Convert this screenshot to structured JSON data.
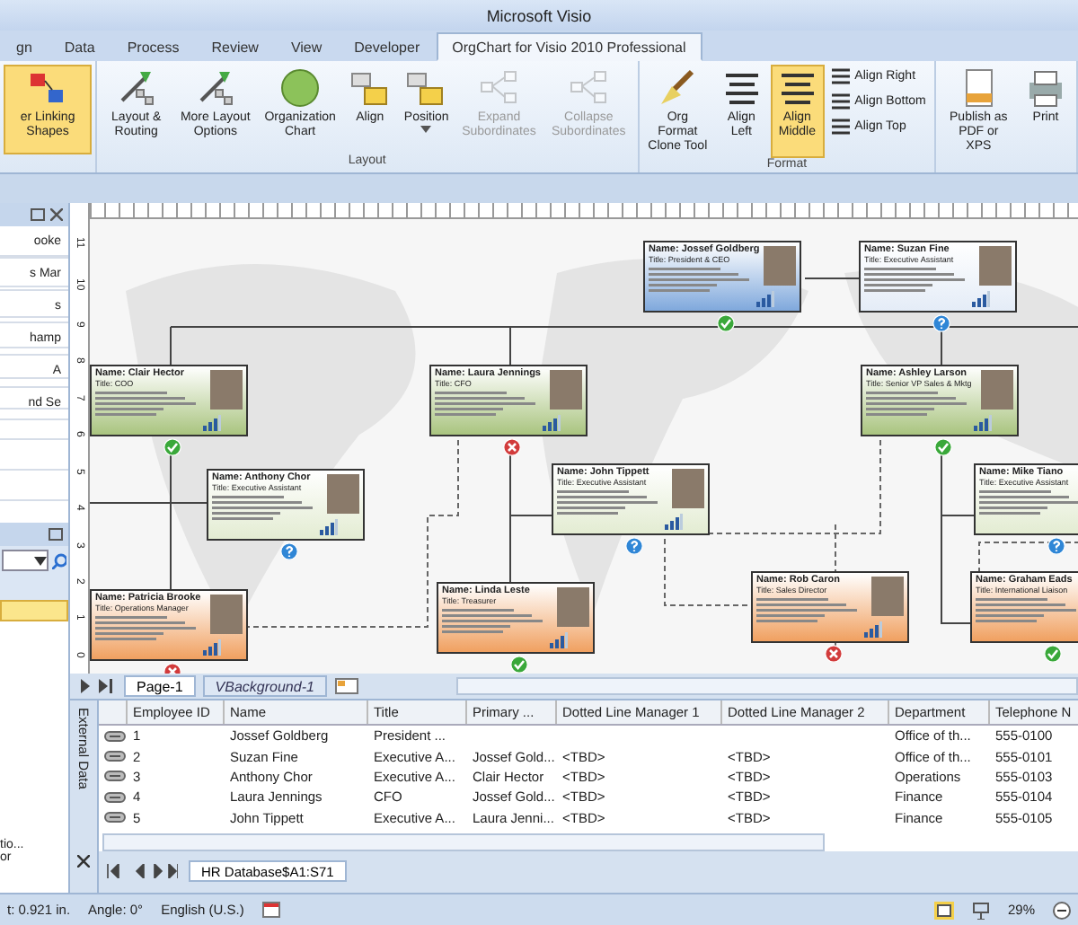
{
  "window": {
    "title": "Microsoft Visio"
  },
  "tabs": [
    {
      "label": "gn",
      "selected": false
    },
    {
      "label": "Data",
      "selected": false
    },
    {
      "label": "Process",
      "selected": false
    },
    {
      "label": "Review",
      "selected": false
    },
    {
      "label": "View",
      "selected": false
    },
    {
      "label": "Developer",
      "selected": false
    },
    {
      "label": "OrgChart for Visio 2010 Professional",
      "selected": true
    }
  ],
  "ribbon": {
    "groups": [
      {
        "buttons": [
          {
            "kind": "large",
            "label": "er Linking Shapes",
            "selected": true,
            "disabled": false
          }
        ]
      },
      {
        "label": "Layout",
        "buttons": [
          {
            "kind": "large",
            "label": "Layout & Routing",
            "selected": false,
            "disabled": false
          },
          {
            "kind": "large",
            "label": "More Layout Options",
            "selected": false,
            "disabled": false
          },
          {
            "kind": "large",
            "label": "Organization Chart",
            "selected": false,
            "disabled": false
          },
          {
            "kind": "large",
            "label": "Align",
            "selected": false,
            "disabled": false
          },
          {
            "kind": "large",
            "label": "Position",
            "selected": false,
            "disabled": false,
            "caret": true
          },
          {
            "kind": "large",
            "label": "Expand Subordinates",
            "selected": false,
            "disabled": true
          },
          {
            "kind": "large",
            "label": "Collapse Subordinates",
            "selected": false,
            "disabled": true
          }
        ]
      },
      {
        "label": "Format",
        "buttons": [
          {
            "kind": "large",
            "label": "Org Format Clone Tool",
            "selected": false,
            "disabled": false
          },
          {
            "kind": "large",
            "label": "Align Left",
            "selected": false,
            "disabled": false
          },
          {
            "kind": "large",
            "label": "Align Middle",
            "selected": true,
            "disabled": false
          },
          {
            "kind": "small",
            "label": "Align Right",
            "selected": false,
            "disabled": false
          },
          {
            "kind": "small",
            "label": "Align Bottom",
            "selected": false,
            "disabled": false
          },
          {
            "kind": "small",
            "label": "Align Top",
            "selected": false,
            "disabled": false
          }
        ]
      },
      {
        "buttons": [
          {
            "kind": "large",
            "label": "Publish as PDF or XPS",
            "selected": false,
            "disabled": false
          },
          {
            "kind": "large",
            "label": "Print",
            "selected": false,
            "disabled": false
          }
        ]
      }
    ]
  },
  "left_panel": {
    "items": [
      "ooke",
      "s Mar",
      "s",
      "hamp",
      "A",
      "nd Se"
    ],
    "lower_items": [
      "tio...",
      "or"
    ]
  },
  "ruler": [
    "11",
    "10",
    "9",
    "8",
    "7",
    "6",
    "5",
    "4",
    "3",
    "2",
    "1",
    "0"
  ],
  "cards": [
    {
      "name": "Name: Jossef Goldberg",
      "title": "Title: President & CEO",
      "color": "#7fa8dc",
      "kind": "ok"
    },
    {
      "name": "Name: Suzan Fine",
      "title": "Title: Executive Assistant",
      "color": "#e4ecf7",
      "kind": "question"
    },
    {
      "name": "Name: Clair Hector",
      "title": "Title: COO",
      "color": "#a9c47f",
      "kind": "ok"
    },
    {
      "name": "Name: Laura Jennings",
      "title": "Title: CFO",
      "color": "#a9c47f",
      "kind": "error"
    },
    {
      "name": "Name: Ashley Larson",
      "title": "Title: Senior VP Sales & Mktg",
      "color": "#a9c47f",
      "kind": "ok"
    },
    {
      "name": "Name: Anthony Chor",
      "title": "Title: Executive Assistant",
      "color": "#e3ecd2",
      "kind": "question"
    },
    {
      "name": "Name: John Tippett",
      "title": "Title: Executive Assistant",
      "color": "#e3ecd2",
      "kind": "question"
    },
    {
      "name": "Name: Mike Tiano",
      "title": "Title: Executive Assistant",
      "color": "#e3ecd2",
      "kind": "question"
    },
    {
      "name": "Name: Patricia Brooke",
      "title": "Title: Operations Manager",
      "color": "#f0a060",
      "kind": "error"
    },
    {
      "name": "Name: Linda Leste",
      "title": "Title: Treasurer",
      "color": "#f0a060",
      "kind": "ok"
    },
    {
      "name": "Name: Rob Caron",
      "title": "Title: Sales Director",
      "color": "#f0a060",
      "kind": "error"
    },
    {
      "name": "Name: Graham Eads",
      "title": "Title: International Liaison",
      "color": "#f0a060",
      "kind": "ok"
    }
  ],
  "page_tabs": [
    {
      "label": "Page-1",
      "selected": true
    },
    {
      "label": "VBackground-1",
      "selected": false
    }
  ],
  "external_data": {
    "label": "External Data",
    "columns": [
      "Employee ID",
      "Name",
      "Title",
      "Primary ...",
      "Dotted Line Manager 1",
      "Dotted Line Manager 2",
      "Department",
      "Telephone N"
    ],
    "rows": [
      [
        "1",
        "Jossef Goldberg",
        "President ...",
        "",
        "",
        "",
        "Office of th...",
        "555-0100"
      ],
      [
        "2",
        "Suzan Fine",
        "Executive A...",
        "Jossef Gold...",
        "<TBD>",
        "<TBD>",
        "Office of th...",
        "555-0101"
      ],
      [
        "3",
        "Anthony Chor",
        "Executive A...",
        "Clair Hector",
        "<TBD>",
        "<TBD>",
        "Operations",
        "555-0103"
      ],
      [
        "4",
        "Laura Jennings",
        "CFO",
        "Jossef Gold...",
        "<TBD>",
        "<TBD>",
        "Finance",
        "555-0104"
      ],
      [
        "5",
        "John Tippett",
        "Executive A...",
        "Laura Jenni...",
        "<TBD>",
        "<TBD>",
        "Finance",
        "555-0105"
      ]
    ],
    "sheet_tab": "HR Database$A1:S71"
  },
  "status_bar": {
    "items": [
      "t: 0.921 in.",
      "Angle: 0°",
      "English (U.S.)"
    ],
    "zoom": "29%"
  }
}
